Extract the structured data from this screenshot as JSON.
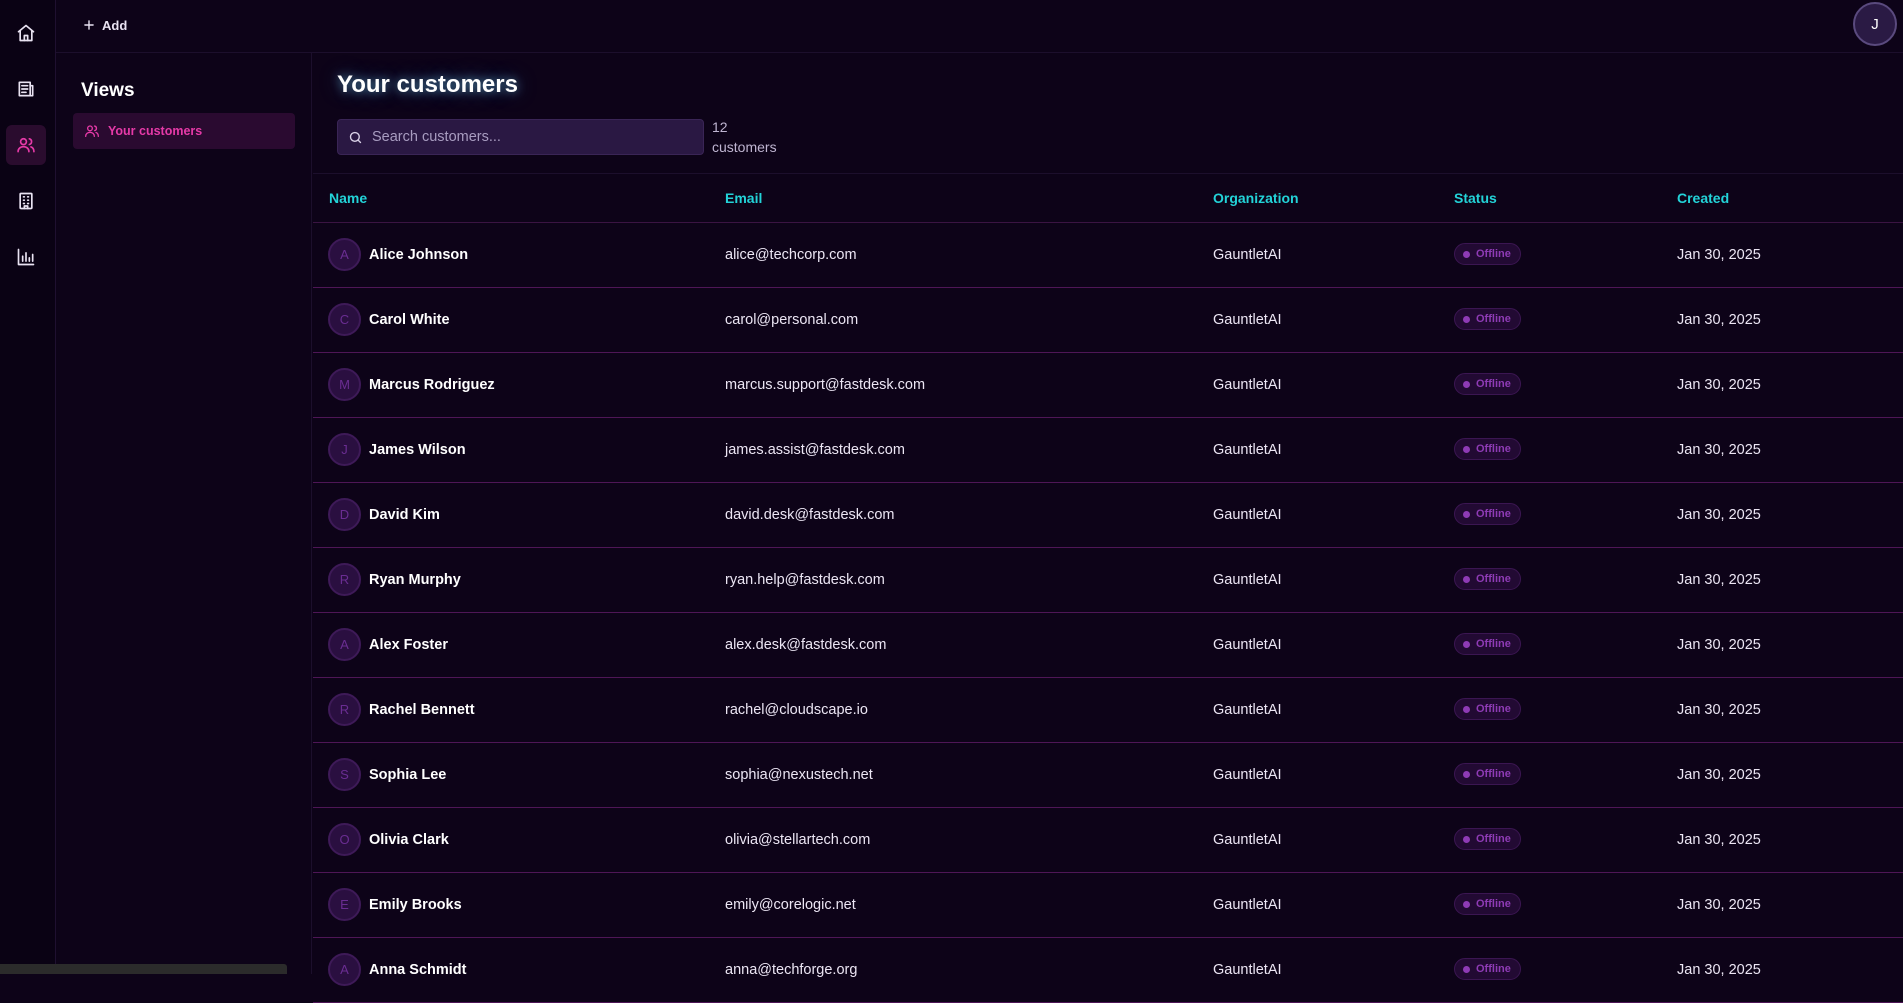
{
  "topbar": {
    "add_label": "Add",
    "user_initial": "J"
  },
  "rail": {
    "items": [
      {
        "icon": "home-icon"
      },
      {
        "icon": "tickets-icon"
      },
      {
        "icon": "users-icon",
        "active": true
      },
      {
        "icon": "building-icon"
      },
      {
        "icon": "chart-icon"
      }
    ]
  },
  "views": {
    "title": "Views",
    "items": [
      {
        "label": "Your customers",
        "icon": "users-icon"
      }
    ]
  },
  "main": {
    "title": "Your customers",
    "search_placeholder": "Search customers...",
    "count_number": "12",
    "count_label": "customers"
  },
  "table": {
    "headers": {
      "name": "Name",
      "email": "Email",
      "organization": "Organization",
      "status": "Status",
      "created": "Created"
    },
    "rows": [
      {
        "initial": "A",
        "name": "Alice Johnson",
        "email": "alice@techcorp.com",
        "organization": "GauntletAI",
        "status": "Offline",
        "created": "Jan 30, 2025"
      },
      {
        "initial": "C",
        "name": "Carol White",
        "email": "carol@personal.com",
        "organization": "GauntletAI",
        "status": "Offline",
        "created": "Jan 30, 2025"
      },
      {
        "initial": "M",
        "name": "Marcus Rodriguez",
        "email": "marcus.support@fastdesk.com",
        "organization": "GauntletAI",
        "status": "Offline",
        "created": "Jan 30, 2025"
      },
      {
        "initial": "J",
        "name": "James Wilson",
        "email": "james.assist@fastdesk.com",
        "organization": "GauntletAI",
        "status": "Offline",
        "created": "Jan 30, 2025"
      },
      {
        "initial": "D",
        "name": "David Kim",
        "email": "david.desk@fastdesk.com",
        "organization": "GauntletAI",
        "status": "Offline",
        "created": "Jan 30, 2025"
      },
      {
        "initial": "R",
        "name": "Ryan Murphy",
        "email": "ryan.help@fastdesk.com",
        "organization": "GauntletAI",
        "status": "Offline",
        "created": "Jan 30, 2025"
      },
      {
        "initial": "A",
        "name": "Alex Foster",
        "email": "alex.desk@fastdesk.com",
        "organization": "GauntletAI",
        "status": "Offline",
        "created": "Jan 30, 2025"
      },
      {
        "initial": "R",
        "name": "Rachel Bennett",
        "email": "rachel@cloudscape.io",
        "organization": "GauntletAI",
        "status": "Offline",
        "created": "Jan 30, 2025"
      },
      {
        "initial": "S",
        "name": "Sophia Lee",
        "email": "sophia@nexustech.net",
        "organization": "GauntletAI",
        "status": "Offline",
        "created": "Jan 30, 2025"
      },
      {
        "initial": "O",
        "name": "Olivia Clark",
        "email": "olivia@stellartech.com",
        "organization": "GauntletAI",
        "status": "Offline",
        "created": "Jan 30, 2025"
      },
      {
        "initial": "E",
        "name": "Emily Brooks",
        "email": "emily@corelogic.net",
        "organization": "GauntletAI",
        "status": "Offline",
        "created": "Jan 30, 2025"
      },
      {
        "initial": "A",
        "name": "Anna Schmidt",
        "email": "anna@techforge.org",
        "organization": "GauntletAI",
        "status": "Offline",
        "created": "Jan 30, 2025"
      }
    ]
  },
  "colors": {
    "accent_pink": "#e63aa8",
    "accent_cyan": "#23d3d8",
    "status_offline": "#8e3bb5",
    "background": "#0d0318"
  }
}
